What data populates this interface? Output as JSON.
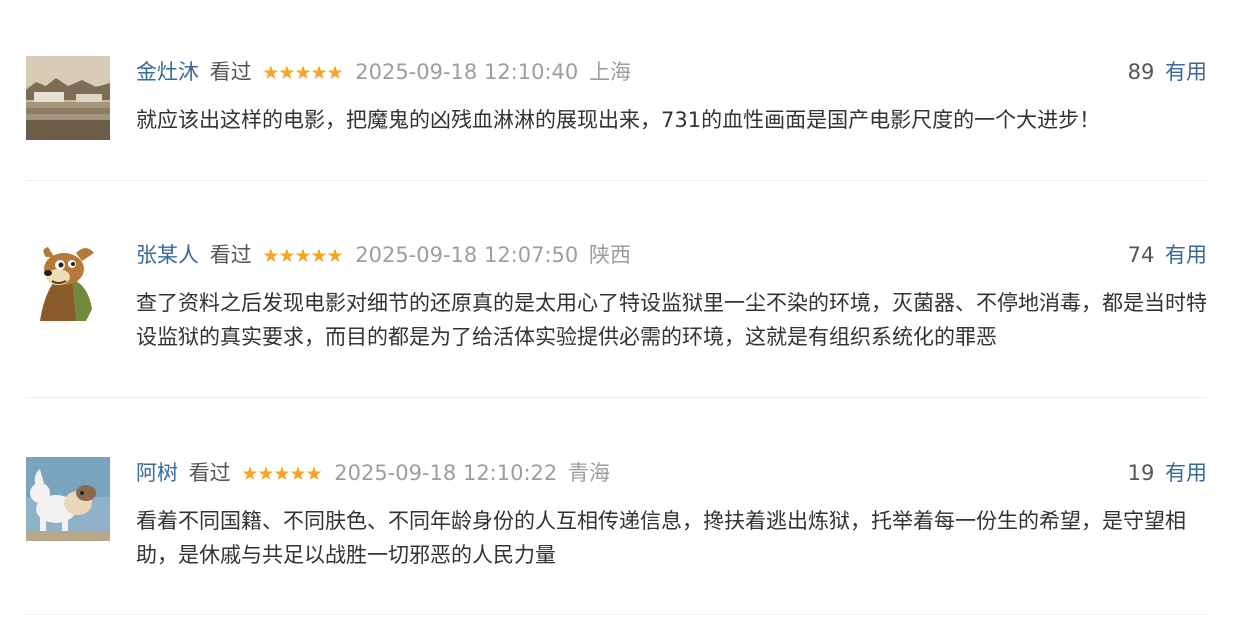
{
  "comments": [
    {
      "username": "金灶沐",
      "status": "看过",
      "rating": 5,
      "stars": "★★★★★",
      "time": "2025-09-18 12:10:40",
      "location": "上海",
      "votes": "89",
      "useful_label": "有用",
      "content": "就应该出这样的电影，把魔鬼的凶残血淋淋的展现出来，731的血性画面是国产电影尺度的一个大进步！"
    },
    {
      "username": "张某人",
      "status": "看过",
      "rating": 5,
      "stars": "★★★★★",
      "time": "2025-09-18 12:07:50",
      "location": "陕西",
      "votes": "74",
      "useful_label": "有用",
      "content": "查了资料之后发现电影对细节的还原真的是太用心了特设监狱里一尘不染的环境，灭菌器、不停地消毒，都是当时特设监狱的真实要求，而目的都是为了给活体实验提供必需的环境，这就是有组织系统化的罪恶"
    },
    {
      "username": "阿树",
      "status": "看过",
      "rating": 5,
      "stars": "★★★★★",
      "time": "2025-09-18 12:10:22",
      "location": "青海",
      "votes": "19",
      "useful_label": "有用",
      "content": "看着不同国籍、不同肤色、不同年龄身份的人互相传递信息，搀扶着逃出炼狱，托举着每一份生的希望，是守望相助，是休戚与共足以战胜一切邪恶的人民力量"
    }
  ],
  "colors": {
    "username": "#37699b",
    "star": "#f5a623",
    "meta": "#9e9e9e",
    "text": "#333333"
  }
}
